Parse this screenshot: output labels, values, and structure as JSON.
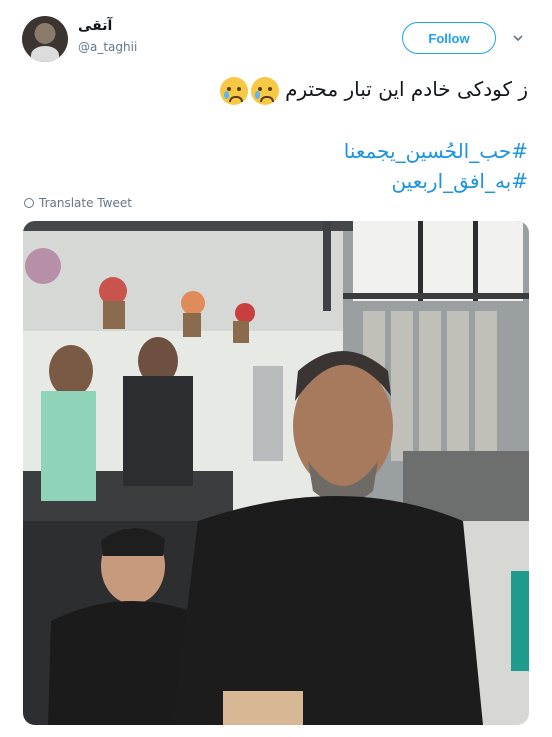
{
  "author": {
    "display_name": "آتقی",
    "handle": "@a_taghii",
    "avatar": "avatar-photo"
  },
  "follow": {
    "label": "Follow"
  },
  "menu": {
    "icon": "chevron-down-icon"
  },
  "tweet": {
    "text": "ز کودکی خادم این تبار محترم",
    "emoji": [
      "crying-face",
      "crying-face"
    ],
    "hashtags": [
      "#حب_الحُسین_یجمعنا",
      "#به_افق_اربعین"
    ]
  },
  "translate": {
    "label": "Translate Tweet",
    "icon": "globe-icon"
  },
  "colors": {
    "accent": "#1da1f2",
    "link": "#1b95e0",
    "muted": "#657786",
    "text": "#14171a"
  }
}
